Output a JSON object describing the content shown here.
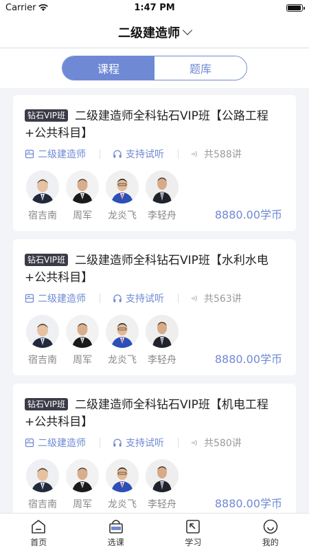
{
  "status_bar": {
    "carrier": "Carrier",
    "time": "1:47 PM"
  },
  "header": {
    "title": "二级建造师"
  },
  "segments": [
    {
      "label": "课程",
      "active": true
    },
    {
      "label": "题库",
      "active": false
    }
  ],
  "courses": [
    {
      "badge": "钻石VIP班",
      "title": "二级建造师全科钻石VIP班【公路工程+公共科目】",
      "category": "二级建造师",
      "trial": "支持试听",
      "lessons": "共588讲",
      "teachers": [
        "宿吉南",
        "周军",
        "龙炎飞",
        "李轻舟"
      ],
      "price": "8880.00学币"
    },
    {
      "badge": "钻石VIP班",
      "title": "二级建造师全科钻石VIP班【水利水电+公共科目】",
      "category": "二级建造师",
      "trial": "支持试听",
      "lessons": "共563讲",
      "teachers": [
        "宿吉南",
        "周军",
        "龙炎飞",
        "李轻舟"
      ],
      "price": "8880.00学币"
    },
    {
      "badge": "钻石VIP班",
      "title": "二级建造师全科钻石VIP班【机电工程+公共科目】",
      "category": "二级建造师",
      "trial": "支持试听",
      "lessons": "共580讲",
      "teachers": [
        "宿吉南",
        "周军",
        "龙炎飞",
        "李轻舟"
      ],
      "price": "8880.00学币"
    }
  ],
  "tabbar": [
    {
      "label": "首页",
      "icon": "home-icon"
    },
    {
      "label": "选课",
      "icon": "basket-icon"
    },
    {
      "label": "学习",
      "icon": "study-icon"
    },
    {
      "label": "我的",
      "icon": "profile-icon"
    }
  ],
  "colors": {
    "accent": "#6f89d4",
    "badge_bg": "#3b3b48",
    "page_bg": "#f3f4f7"
  }
}
